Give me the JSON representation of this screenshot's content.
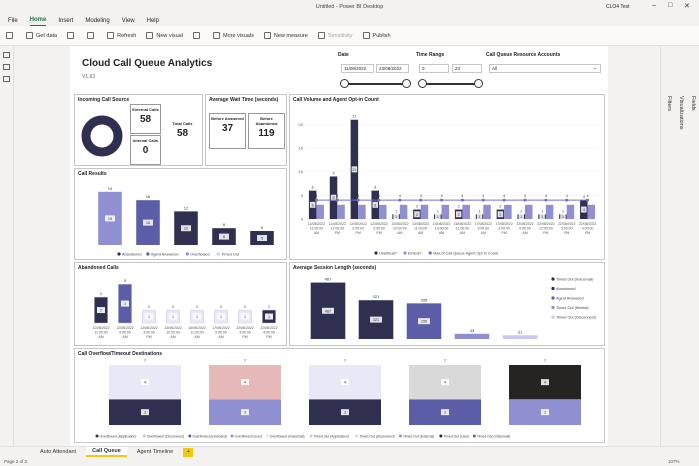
{
  "window": {
    "title": "Untitled - Power BI Desktop",
    "user": "CLO4 Test"
  },
  "menu": [
    "File",
    "Home",
    "Insert",
    "Modeling",
    "View",
    "Help"
  ],
  "menu_active": "Home",
  "ribbon": {
    "get_data": "Get data",
    "refresh": "Refresh",
    "new_visual": "New visual",
    "more_visuals": "More visuals",
    "new_measure": "New measure",
    "sensitivity": "Sensitivity",
    "publish": "Publish"
  },
  "panes": {
    "filters": "Filters",
    "visualizations": "Visualizations",
    "fields": "Fields"
  },
  "report": {
    "title": "Cloud Call Queue Analytics",
    "version": "V1.63"
  },
  "slicers": {
    "date": {
      "label": "Date",
      "from": "11/08/2022",
      "to": "23/08/2022",
      "handle_start": 0.0,
      "handle_end": 1.0
    },
    "time": {
      "label": "Time Range",
      "from": "0",
      "to": "23",
      "handle_start": 0.0,
      "handle_end": 1.0
    },
    "accounts": {
      "label": "Call Queue Resource Accounts",
      "value": "All"
    }
  },
  "incoming": {
    "title": "Incoming Call Source",
    "external_label": "External Calls",
    "external_value": "58",
    "internal_label": "Internal Calls",
    "internal_value": "0",
    "total_label": "Total Calls",
    "total_value": "58"
  },
  "wait": {
    "title": "Average Wait Time (seconds)",
    "before_answered_label": "Before Answered",
    "before_answered_value": "37",
    "before_abandoned_label": "Before Abandoned",
    "before_abandoned_value": "119"
  },
  "colors": {
    "navy": "#2f2f4f",
    "purple": "#5b5ea6",
    "lavender": "#8f8fd1",
    "pale": "#c9c9f0",
    "pink": "#e6b8b8",
    "light": "#e8e8f6",
    "grey": "#d9d9d9",
    "black": "#252423",
    "accent": "#f2c811",
    "line": "#7a6fbf"
  },
  "chart_data": [
    {
      "id": "call_results",
      "type": "bar",
      "title": "Call Results",
      "categories": [
        "Abandoned",
        "Agent Answered",
        "Overflowed",
        "Timed Out"
      ],
      "values": [
        19,
        16,
        12,
        6,
        5
      ],
      "bars": [
        {
          "series": "Abandoned",
          "value": 19,
          "label": "19"
        },
        {
          "series": "Agent Answered",
          "value": 16,
          "label": "16"
        },
        {
          "series": "Overflowed",
          "value": 12,
          "label": "12"
        },
        {
          "series": "Timed Out",
          "value": 6,
          "label": "6"
        },
        {
          "series": "Timed Out",
          "value": 5,
          "label": "5"
        }
      ],
      "legend": [
        "Abandoned",
        "Agent Answered",
        "Overflowed",
        "Timed Out"
      ],
      "ylim": [
        0,
        20
      ]
    },
    {
      "id": "volume",
      "type": "bar",
      "title": "Call Volume and Agent Opt-in Count",
      "categories": [
        "11/08/2022 11:00:00 AM",
        "11/08/2022 12:00:00 PM",
        "12/08/2022 2:00:00 PM",
        "12/08/2022 3:00:00 PM",
        "13/08/2022 10:00:00 AM",
        "13/08/2022 11:00:00 AM",
        "16/08/2022 10:00:00 AM",
        "16/08/2022 11:00:00 AM",
        "17/08/2022 9:00:00 AM",
        "17/08/2022 3:00:00 PM",
        "22/08/2022 9:00:00 AM",
        "22/08/2022 12:00:00 PM",
        "22/08/2022 3:00:00 PM",
        "22/08/2022 4:00:00 PM"
      ],
      "series": [
        {
          "name": "Unethical?",
          "values": [
            6,
            9,
            21,
            6,
            1,
            2,
            1,
            2,
            1,
            2,
            1,
            1,
            1,
            4
          ]
        },
        {
          "name": "Ethical?",
          "values": [
            3,
            3,
            3,
            3,
            3,
            3,
            3,
            3,
            3,
            3,
            3,
            3,
            3,
            3
          ]
        }
      ],
      "line": {
        "name": "Max of Call Queue Agent Opt In Count",
        "values": [
          4,
          4,
          4,
          4,
          4,
          4,
          4,
          4,
          4,
          4,
          4,
          4,
          4,
          4
        ]
      },
      "legend": [
        "Unethical?",
        "Ethical?",
        "Max of Call Queue Agent Opt In Count"
      ],
      "yticks": [
        "0",
        "5",
        "10",
        "15",
        "20"
      ],
      "ylim": [
        0,
        22
      ]
    },
    {
      "id": "abandoned",
      "type": "bar",
      "title": "Abandoned Calls",
      "categories": [
        "11/08/2022 11:00:00 AM",
        "12/08/2022 9:00:00 AM",
        "12/08/2022 3:00:00 PM",
        "13/08/2022 10:00:00 AM",
        "16/08/2022 11:00:00 AM",
        "17/08/2022 9:00:00 AM",
        "22/08/2022 3:00:00 PM",
        "22/08/2022 4:00:00 PM"
      ],
      "values": [
        2,
        3,
        1,
        1,
        1,
        1,
        1,
        1
      ],
      "ylim": [
        0,
        3.4
      ]
    },
    {
      "id": "session",
      "type": "bar",
      "title": "Average Session Length (seconds)",
      "categories": [
        "Timed Out (Voicemail)",
        "Abandoned",
        "Agent Answered",
        "Timed Out (Mental)",
        "Timed Out (Disconnect)"
      ],
      "values": [
        467,
        321,
        295,
        43,
        31
      ],
      "legend": [
        "Timed Out (Voicemail)",
        "Abandoned",
        "Agent Answered",
        "Timed Out (Mental)",
        "Timed Out (Disconnect)"
      ],
      "ylim": [
        0,
        480
      ]
    },
    {
      "id": "overflow",
      "type": "bar",
      "title": "Call Overflow/Timeout Destinations",
      "columns": [
        {
          "top": 4,
          "bottom": 3
        },
        {
          "top": 4,
          "bottom": 3
        },
        {
          "top": 4,
          "bottom": 3
        },
        {
          "top": 4,
          "bottom": 3
        },
        {
          "top": 4,
          "bottom": 3
        }
      ],
      "totals": [
        "7",
        "7",
        "7",
        "7",
        "7"
      ],
      "legend": [
        "Overflowed (Application)",
        "Overflowed (Disconnect)",
        "Overflowed (Extended)",
        "Overflowed (User)",
        "Overflowed (Voicemail)",
        "Timed Out (Application)",
        "Timed Out (Disconnect)",
        "Timed Out (External)",
        "Timed Out (User)",
        "Timed Out (Voicemail)"
      ]
    }
  ],
  "tabs": [
    "Auto Attendant",
    "Call Queue",
    "Agent Timeline"
  ],
  "tab_active": "Call Queue",
  "status": {
    "page": "Page 2 of 3",
    "zoom": "107%"
  }
}
